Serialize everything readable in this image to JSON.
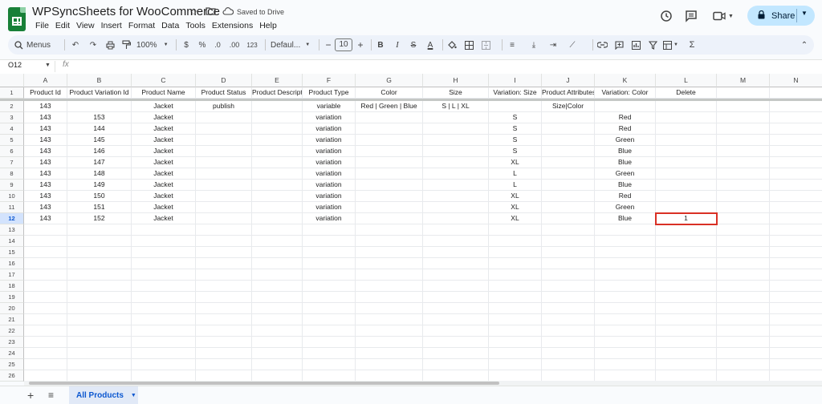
{
  "header": {
    "title": "WPSyncSheets for WooCommerce",
    "saved_status": "Saved to Drive",
    "share_label": "Share",
    "icons": [
      "star-icon",
      "move-to-folder-icon",
      "cloud-saved-icon",
      "history-icon",
      "comment-icon",
      "meet-icon",
      "lock-icon"
    ]
  },
  "menu": [
    "File",
    "Edit",
    "View",
    "Insert",
    "Format",
    "Data",
    "Tools",
    "Extensions",
    "Help"
  ],
  "toolbar": {
    "search_label": "Menus",
    "zoom": "100%",
    "currency": "$",
    "percent": "%",
    "decrease_decimal": ".0",
    "increase_decimal": ".00",
    "number_format": "123",
    "font": "Defaul...",
    "font_size": "10",
    "minus": "−",
    "plus": "+",
    "bold": "B",
    "italic": "I",
    "strike": "S",
    "text_color": "A",
    "sigma": "Σ"
  },
  "formula_bar": {
    "cell_ref": "O12",
    "fx": "fx"
  },
  "grid": {
    "columns": [
      "A",
      "B",
      "C",
      "D",
      "E",
      "F",
      "G",
      "H",
      "I",
      "J",
      "K",
      "L",
      "M",
      "N"
    ],
    "col_widths": [
      54,
      80,
      80,
      70,
      63,
      66,
      84,
      82,
      66,
      66,
      76,
      76,
      66,
      66
    ],
    "row_numbers": [
      "1",
      "2",
      "3",
      "4",
      "5",
      "6",
      "7",
      "8",
      "9",
      "10",
      "11",
      "12",
      "13",
      "14",
      "15",
      "16",
      "17",
      "18",
      "19",
      "20",
      "21",
      "22",
      "23",
      "24",
      "25",
      "26"
    ],
    "rows": [
      [
        "Product Id",
        "Product Variation Id",
        "Product Name",
        "Product Status",
        "Product Description",
        "Product Type",
        "Color",
        "Size",
        "Variation: Size",
        "Product Attributes",
        "Variation: Color",
        "Delete",
        "",
        ""
      ],
      [
        "143",
        "",
        "Jacket",
        "publish",
        "",
        "variable",
        "Red | Green | Blue",
        "S | L | XL",
        "",
        "Size|Color",
        "",
        "",
        "",
        ""
      ],
      [
        "143",
        "153",
        "Jacket",
        "",
        "",
        "variation",
        "",
        "",
        "S",
        "",
        "Red",
        "",
        "",
        ""
      ],
      [
        "143",
        "144",
        "Jacket",
        "",
        "",
        "variation",
        "",
        "",
        "S",
        "",
        "Red",
        "",
        "",
        ""
      ],
      [
        "143",
        "145",
        "Jacket",
        "",
        "",
        "variation",
        "",
        "",
        "S",
        "",
        "Green",
        "",
        "",
        ""
      ],
      [
        "143",
        "146",
        "Jacket",
        "",
        "",
        "variation",
        "",
        "",
        "S",
        "",
        "Blue",
        "",
        "",
        ""
      ],
      [
        "143",
        "147",
        "Jacket",
        "",
        "",
        "variation",
        "",
        "",
        "XL",
        "",
        "Blue",
        "",
        "",
        ""
      ],
      [
        "143",
        "148",
        "Jacket",
        "",
        "",
        "variation",
        "",
        "",
        "L",
        "",
        "Green",
        "",
        "",
        ""
      ],
      [
        "143",
        "149",
        "Jacket",
        "",
        "",
        "variation",
        "",
        "",
        "L",
        "",
        "Blue",
        "",
        "",
        ""
      ],
      [
        "143",
        "150",
        "Jacket",
        "",
        "",
        "variation",
        "",
        "",
        "XL",
        "",
        "Red",
        "",
        "",
        ""
      ],
      [
        "143",
        "151",
        "Jacket",
        "",
        "",
        "variation",
        "",
        "",
        "XL",
        "",
        "Green",
        "",
        "",
        ""
      ],
      [
        "143",
        "152",
        "Jacket",
        "",
        "",
        "variation",
        "",
        "",
        "XL",
        "",
        "Blue",
        "1",
        "",
        ""
      ]
    ],
    "selected_cell": {
      "row": 12,
      "col": "L"
    },
    "selection_color": "#d93025"
  },
  "sheet_tabs": {
    "active": "All Products"
  },
  "colors": {
    "brand": "#188038",
    "share_bg": "#c2e7ff",
    "tab_active": "#0b57d0"
  }
}
